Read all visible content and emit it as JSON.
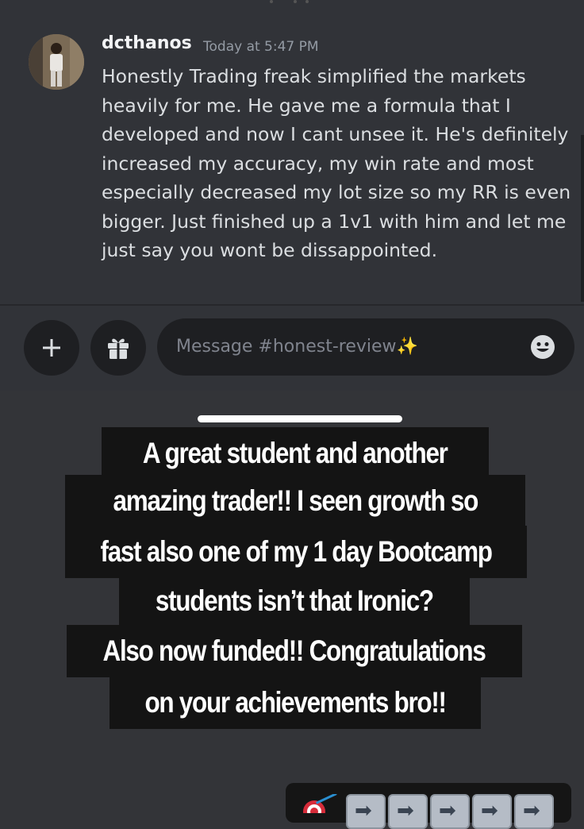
{
  "message": {
    "username": "dcthanos",
    "timestamp": "Today at 5:47 PM",
    "lines": [
      "Honestly Trading freak simplified the markets",
      "heavily for me. He gave me a formula that I",
      "developed and now I cant unsee it. He's definitely",
      "increased my accuracy, my win rate and most",
      "especially decreased my lot size so my RR is even",
      "bigger. Just finished up a 1v1 with him and let me",
      "just say you wont be dissappointed."
    ]
  },
  "composer": {
    "placeholder": "Message #honest-review✨",
    "plus_icon": "plus-icon",
    "gift_icon": "gift-icon",
    "emoji_icon": "smile-emoji-icon"
  },
  "story_caption": [
    "A great student and another",
    "amazing trader!! I seen growth so",
    "fast also one of my 1 day Bootcamp",
    "students isn’t that Ironic?",
    "Also now funded!! Congratulations",
    "on your achievements bro!!"
  ],
  "reply_icons": [
    "dart-icon",
    "right-arrow-icon",
    "right-arrow-icon",
    "right-arrow-icon",
    "right-arrow-icon",
    "right-arrow-icon"
  ],
  "colors": {
    "chat_background": "#313338",
    "caption_background": "#141414",
    "caption_text": "#ffffff"
  }
}
